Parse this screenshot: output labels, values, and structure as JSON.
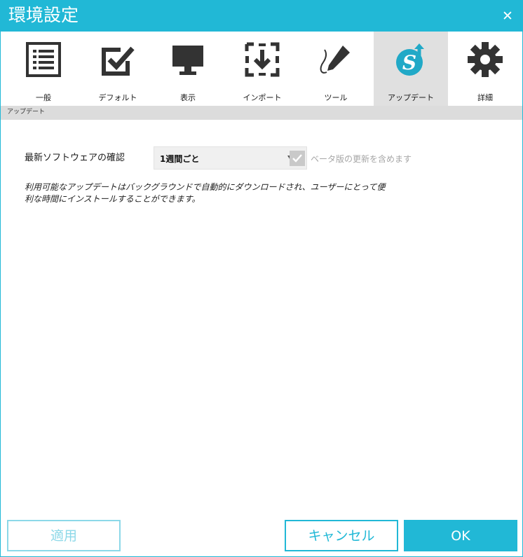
{
  "window": {
    "title": "環境設定",
    "close_symbol": "✕",
    "accent_color": "#21b8d6"
  },
  "tabs": [
    {
      "label": "一般",
      "icon": "list-icon"
    },
    {
      "label": "デフォルト",
      "icon": "checkbox-icon"
    },
    {
      "label": "表示",
      "icon": "monitor-icon"
    },
    {
      "label": "インポート",
      "icon": "import-icon"
    },
    {
      "label": "ツール",
      "icon": "pen-icon"
    },
    {
      "label": "アップデート",
      "icon": "update-logo-icon",
      "active": true
    },
    {
      "label": "詳細",
      "icon": "gear-icon"
    }
  ],
  "breadcrumb": "アップデート",
  "update": {
    "check_label": "最新ソフトウェアの確認",
    "frequency_value": "1週間ごと",
    "beta_label": "ベータ版の更新を含めます",
    "beta_checked": true,
    "note_line1": "利用可能なアップデートはバックグラウンドで自動的にダウンロードされ、ユーザーにとって便",
    "note_line2": "利な時間にインストールすることができます。"
  },
  "buttons": {
    "apply": "適用",
    "cancel": "キャンセル",
    "ok": "OK"
  }
}
